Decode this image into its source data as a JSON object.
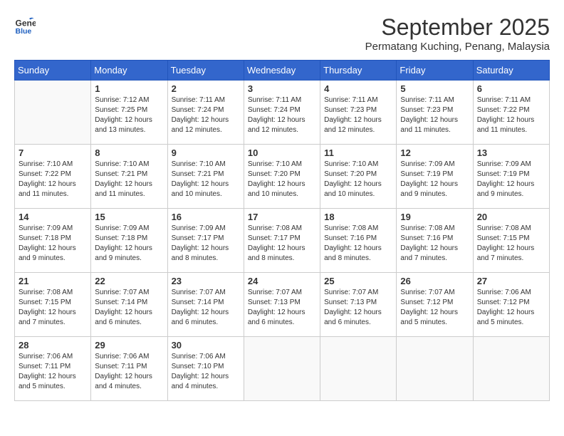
{
  "header": {
    "logo_line1": "General",
    "logo_line2": "Blue",
    "month": "September 2025",
    "location": "Permatang Kuching, Penang, Malaysia"
  },
  "weekdays": [
    "Sunday",
    "Monday",
    "Tuesday",
    "Wednesday",
    "Thursday",
    "Friday",
    "Saturday"
  ],
  "weeks": [
    [
      {
        "day": "",
        "info": ""
      },
      {
        "day": "1",
        "info": "Sunrise: 7:12 AM\nSunset: 7:25 PM\nDaylight: 12 hours\nand 13 minutes."
      },
      {
        "day": "2",
        "info": "Sunrise: 7:11 AM\nSunset: 7:24 PM\nDaylight: 12 hours\nand 12 minutes."
      },
      {
        "day": "3",
        "info": "Sunrise: 7:11 AM\nSunset: 7:24 PM\nDaylight: 12 hours\nand 12 minutes."
      },
      {
        "day": "4",
        "info": "Sunrise: 7:11 AM\nSunset: 7:23 PM\nDaylight: 12 hours\nand 12 minutes."
      },
      {
        "day": "5",
        "info": "Sunrise: 7:11 AM\nSunset: 7:23 PM\nDaylight: 12 hours\nand 11 minutes."
      },
      {
        "day": "6",
        "info": "Sunrise: 7:11 AM\nSunset: 7:22 PM\nDaylight: 12 hours\nand 11 minutes."
      }
    ],
    [
      {
        "day": "7",
        "info": "Sunrise: 7:10 AM\nSunset: 7:22 PM\nDaylight: 12 hours\nand 11 minutes."
      },
      {
        "day": "8",
        "info": "Sunrise: 7:10 AM\nSunset: 7:21 PM\nDaylight: 12 hours\nand 11 minutes."
      },
      {
        "day": "9",
        "info": "Sunrise: 7:10 AM\nSunset: 7:21 PM\nDaylight: 12 hours\nand 10 minutes."
      },
      {
        "day": "10",
        "info": "Sunrise: 7:10 AM\nSunset: 7:20 PM\nDaylight: 12 hours\nand 10 minutes."
      },
      {
        "day": "11",
        "info": "Sunrise: 7:10 AM\nSunset: 7:20 PM\nDaylight: 12 hours\nand 10 minutes."
      },
      {
        "day": "12",
        "info": "Sunrise: 7:09 AM\nSunset: 7:19 PM\nDaylight: 12 hours\nand 9 minutes."
      },
      {
        "day": "13",
        "info": "Sunrise: 7:09 AM\nSunset: 7:19 PM\nDaylight: 12 hours\nand 9 minutes."
      }
    ],
    [
      {
        "day": "14",
        "info": "Sunrise: 7:09 AM\nSunset: 7:18 PM\nDaylight: 12 hours\nand 9 minutes."
      },
      {
        "day": "15",
        "info": "Sunrise: 7:09 AM\nSunset: 7:18 PM\nDaylight: 12 hours\nand 9 minutes."
      },
      {
        "day": "16",
        "info": "Sunrise: 7:09 AM\nSunset: 7:17 PM\nDaylight: 12 hours\nand 8 minutes."
      },
      {
        "day": "17",
        "info": "Sunrise: 7:08 AM\nSunset: 7:17 PM\nDaylight: 12 hours\nand 8 minutes."
      },
      {
        "day": "18",
        "info": "Sunrise: 7:08 AM\nSunset: 7:16 PM\nDaylight: 12 hours\nand 8 minutes."
      },
      {
        "day": "19",
        "info": "Sunrise: 7:08 AM\nSunset: 7:16 PM\nDaylight: 12 hours\nand 7 minutes."
      },
      {
        "day": "20",
        "info": "Sunrise: 7:08 AM\nSunset: 7:15 PM\nDaylight: 12 hours\nand 7 minutes."
      }
    ],
    [
      {
        "day": "21",
        "info": "Sunrise: 7:08 AM\nSunset: 7:15 PM\nDaylight: 12 hours\nand 7 minutes."
      },
      {
        "day": "22",
        "info": "Sunrise: 7:07 AM\nSunset: 7:14 PM\nDaylight: 12 hours\nand 6 minutes."
      },
      {
        "day": "23",
        "info": "Sunrise: 7:07 AM\nSunset: 7:14 PM\nDaylight: 12 hours\nand 6 minutes."
      },
      {
        "day": "24",
        "info": "Sunrise: 7:07 AM\nSunset: 7:13 PM\nDaylight: 12 hours\nand 6 minutes."
      },
      {
        "day": "25",
        "info": "Sunrise: 7:07 AM\nSunset: 7:13 PM\nDaylight: 12 hours\nand 6 minutes."
      },
      {
        "day": "26",
        "info": "Sunrise: 7:07 AM\nSunset: 7:12 PM\nDaylight: 12 hours\nand 5 minutes."
      },
      {
        "day": "27",
        "info": "Sunrise: 7:06 AM\nSunset: 7:12 PM\nDaylight: 12 hours\nand 5 minutes."
      }
    ],
    [
      {
        "day": "28",
        "info": "Sunrise: 7:06 AM\nSunset: 7:11 PM\nDaylight: 12 hours\nand 5 minutes."
      },
      {
        "day": "29",
        "info": "Sunrise: 7:06 AM\nSunset: 7:11 PM\nDaylight: 12 hours\nand 4 minutes."
      },
      {
        "day": "30",
        "info": "Sunrise: 7:06 AM\nSunset: 7:10 PM\nDaylight: 12 hours\nand 4 minutes."
      },
      {
        "day": "",
        "info": ""
      },
      {
        "day": "",
        "info": ""
      },
      {
        "day": "",
        "info": ""
      },
      {
        "day": "",
        "info": ""
      }
    ]
  ]
}
